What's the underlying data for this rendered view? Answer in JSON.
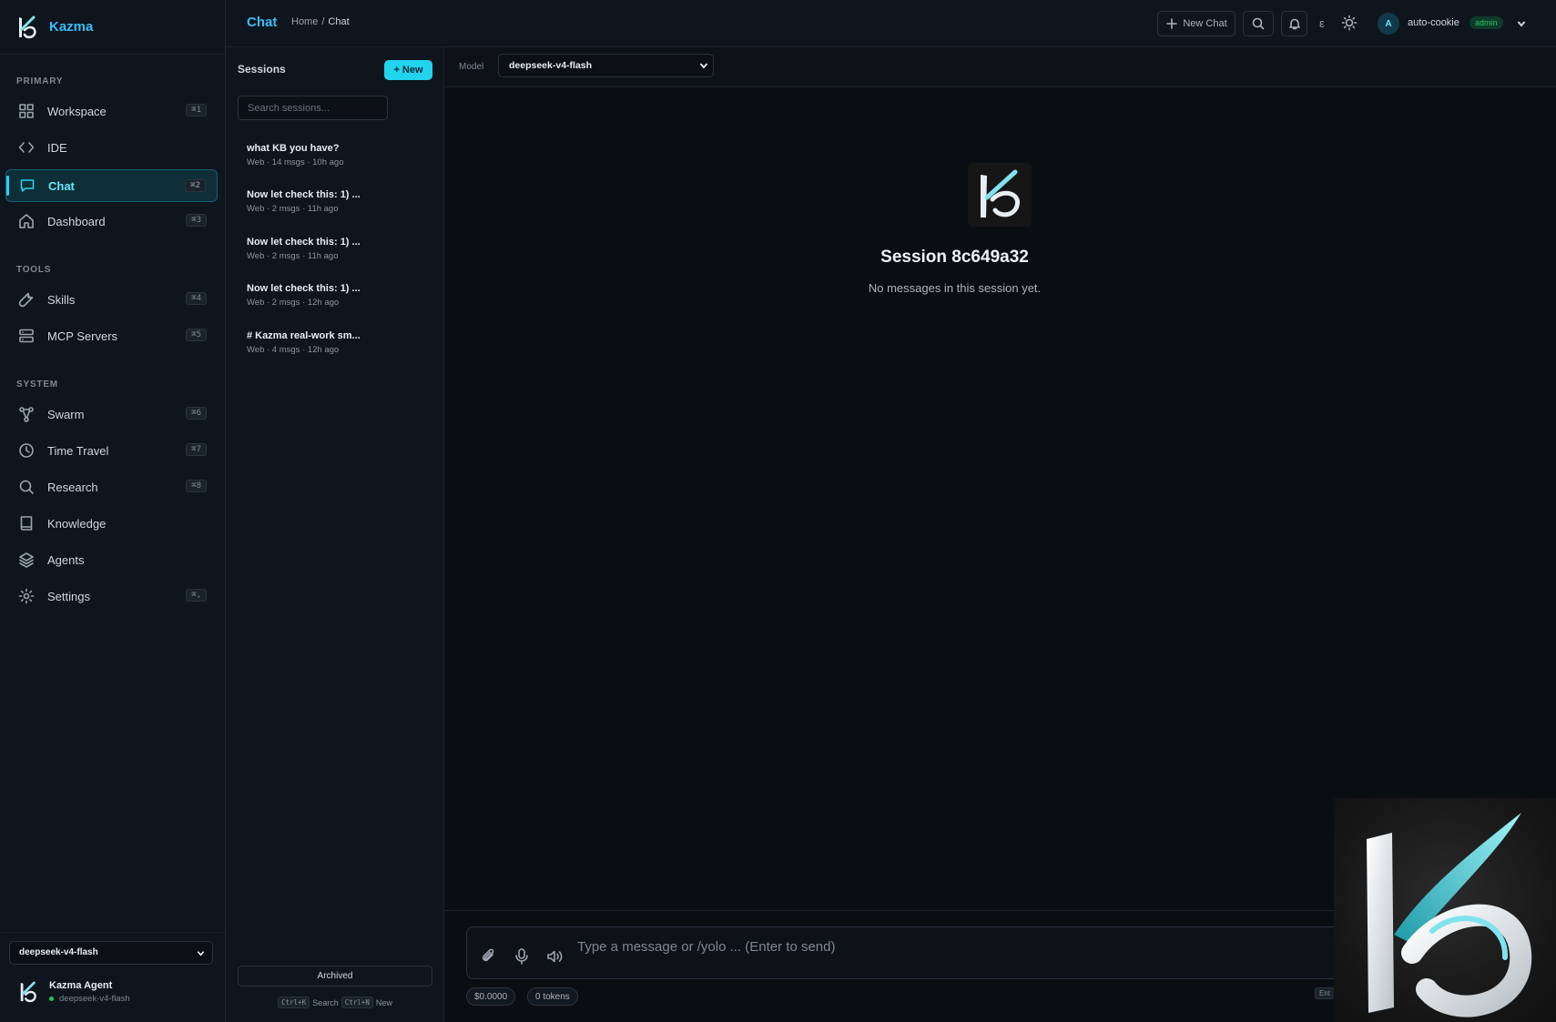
{
  "app": {
    "name": "Kazma"
  },
  "sidebar": {
    "sections": [
      {
        "label": "PRIMARY"
      },
      {
        "label": "TOOLS"
      },
      {
        "label": "SYSTEM"
      }
    ],
    "items": [
      {
        "label": "Workspace",
        "shortcut": "⌘1",
        "icon": "grid-icon"
      },
      {
        "label": "IDE",
        "shortcut": "",
        "icon": "code-icon"
      },
      {
        "label": "Chat",
        "shortcut": "⌘2",
        "icon": "chat-icon",
        "active": true
      },
      {
        "label": "Dashboard",
        "shortcut": "⌘3",
        "icon": "home-icon"
      },
      {
        "label": "Skills",
        "shortcut": "⌘4",
        "icon": "wrench-icon"
      },
      {
        "label": "MCP Servers",
        "shortcut": "⌘5",
        "icon": "server-icon"
      },
      {
        "label": "Swarm",
        "shortcut": "⌘6",
        "icon": "swarm-icon"
      },
      {
        "label": "Time Travel",
        "shortcut": "⌘7",
        "icon": "clock-icon"
      },
      {
        "label": "Research",
        "shortcut": "⌘8",
        "icon": "search-icon"
      },
      {
        "label": "Knowledge",
        "shortcut": "",
        "icon": "book-icon"
      },
      {
        "label": "Agents",
        "shortcut": "",
        "icon": "layers-icon"
      },
      {
        "label": "Settings",
        "shortcut": "⌘,",
        "icon": "gear-icon"
      }
    ],
    "model_select": "deepseek-v4-flash",
    "agent": {
      "name": "Kazma Agent",
      "model": "deepseek-v4-flash",
      "status_color": "#22c55e"
    }
  },
  "topbar": {
    "title": "Chat",
    "breadcrumb": {
      "home": "Home",
      "separator": "/",
      "current": "Chat"
    },
    "new_chat_label": "New Chat",
    "misc_glyph": "ε",
    "user": {
      "initial": "A",
      "name": "auto-cookie",
      "role": "admin"
    }
  },
  "sessions": {
    "title": "Sessions",
    "new_label": "+ New",
    "search_placeholder": "Search sessions...",
    "items": [
      {
        "title": "what KB you have?",
        "meta": "Web · 14 msgs · 10h ago"
      },
      {
        "title": "Now let check this: 1) ...",
        "meta": "Web · 2 msgs · 11h ago"
      },
      {
        "title": "Now let check this: 1) ...",
        "meta": "Web · 2 msgs · 11h ago"
      },
      {
        "title": "Now let check this: 1) ...",
        "meta": "Web · 2 msgs · 12h ago"
      },
      {
        "title": "# Kazma real-work sm...",
        "meta": "Web · 4 msgs · 12h ago"
      }
    ],
    "archived_label": "Archived",
    "hints": {
      "search_key": "Ctrl+K",
      "search_label": "Search",
      "new_key": "Ctrl+N",
      "new_label": "New"
    }
  },
  "main": {
    "model_label": "Model",
    "model_value": "deepseek-v4-flash",
    "session_heading": "Session 8c649a32",
    "session_sub": "No messages in this session yet.",
    "composer_placeholder": "Type a message or /yolo ... (Enter to send)",
    "cost": "$0.0000",
    "tokens": "0 tokens",
    "enter_hint": "Ent"
  },
  "colors": {
    "accent": "#22d3ee",
    "brand": "#38bdf8",
    "success": "#22c55e",
    "background": "#0b0f14"
  }
}
